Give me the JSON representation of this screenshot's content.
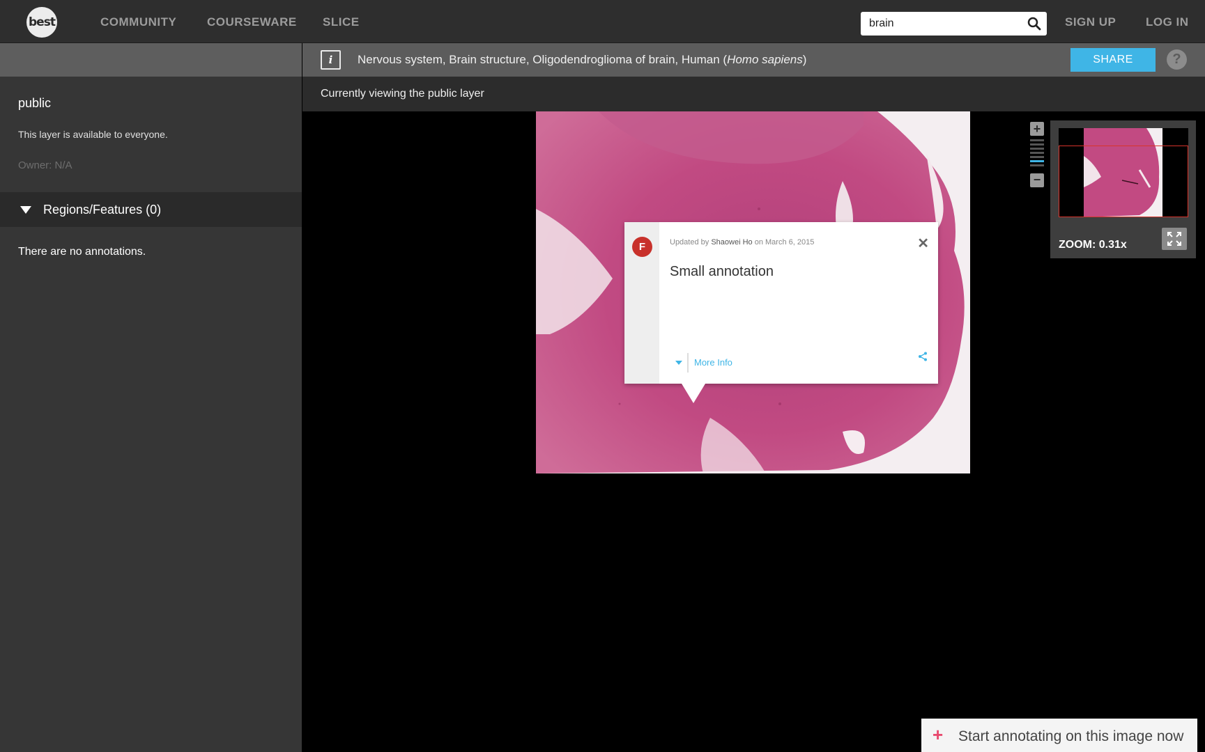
{
  "nav": {
    "logo": "best",
    "links": [
      "COMMUNITY",
      "COURSEWARE",
      "SLICE"
    ],
    "search_value": "brain",
    "sign_up": "SIGN UP",
    "log_in": "LOG IN"
  },
  "infobar": {
    "title_prefix": "Nervous system, Brain structure, Oligodendroglioma of brain, Human (",
    "title_species": "Homo sapiens",
    "title_suffix": ")",
    "share_label": "SHARE",
    "help_label": "?"
  },
  "sidebar": {
    "layer_name": "public",
    "layer_description": "This layer is available to everyone.",
    "owner": "Owner: N/A",
    "regions_label": "Regions/Features (0)",
    "empty_message": "There are no annotations."
  },
  "viewer": {
    "layer_status": "Currently viewing the public layer",
    "zoom_level": "ZOOM: 0.31x"
  },
  "popup": {
    "avatar_letter": "F",
    "updated_prefix": "Updated by",
    "updated_user": "Shaowei Ho",
    "updated_suffix": "on March 6, 2015",
    "title": "Small annotation",
    "more_info": "More Info"
  },
  "cta": {
    "label": "Start annotating on this image now"
  },
  "colors": {
    "accent": "#3fb5e6",
    "cta_plus": "#e84a6f",
    "avatar": "#c8312b",
    "tissue": "#c4467e"
  }
}
